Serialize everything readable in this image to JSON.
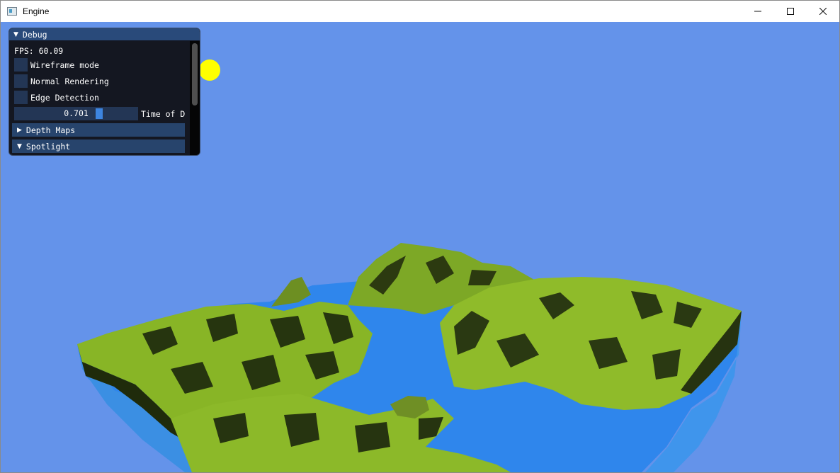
{
  "window": {
    "title": "Engine",
    "controls": {
      "minimize": "—",
      "maximize": "☐",
      "close": "✕"
    }
  },
  "debug_panel": {
    "title": "Debug",
    "fps_text": "FPS: 60.09",
    "checkboxes": [
      {
        "label": "Wireframe mode",
        "checked": false
      },
      {
        "label": "Normal Rendering",
        "checked": false
      },
      {
        "label": "Edge Detection",
        "checked": false
      }
    ],
    "slider": {
      "value": 0.701,
      "value_text": "0.701",
      "label": "Time of D"
    },
    "headers": [
      {
        "label": "Depth Maps",
        "expanded": false
      },
      {
        "label": "Spotlight",
        "expanded": true
      }
    ],
    "scroll_position": 0.0,
    "scroll_visible_fraction": 0.57
  },
  "scene": {
    "sky_color": "#6493ea",
    "sun_color": "#ffff00",
    "water_color": "#2f86ec",
    "terrain_color": "#8fbb2a",
    "terrain_dark_color": "#263310"
  },
  "icons": {
    "window_app": "app-icon",
    "collapse": "triangle-down-icon",
    "expand": "triangle-right-icon"
  }
}
